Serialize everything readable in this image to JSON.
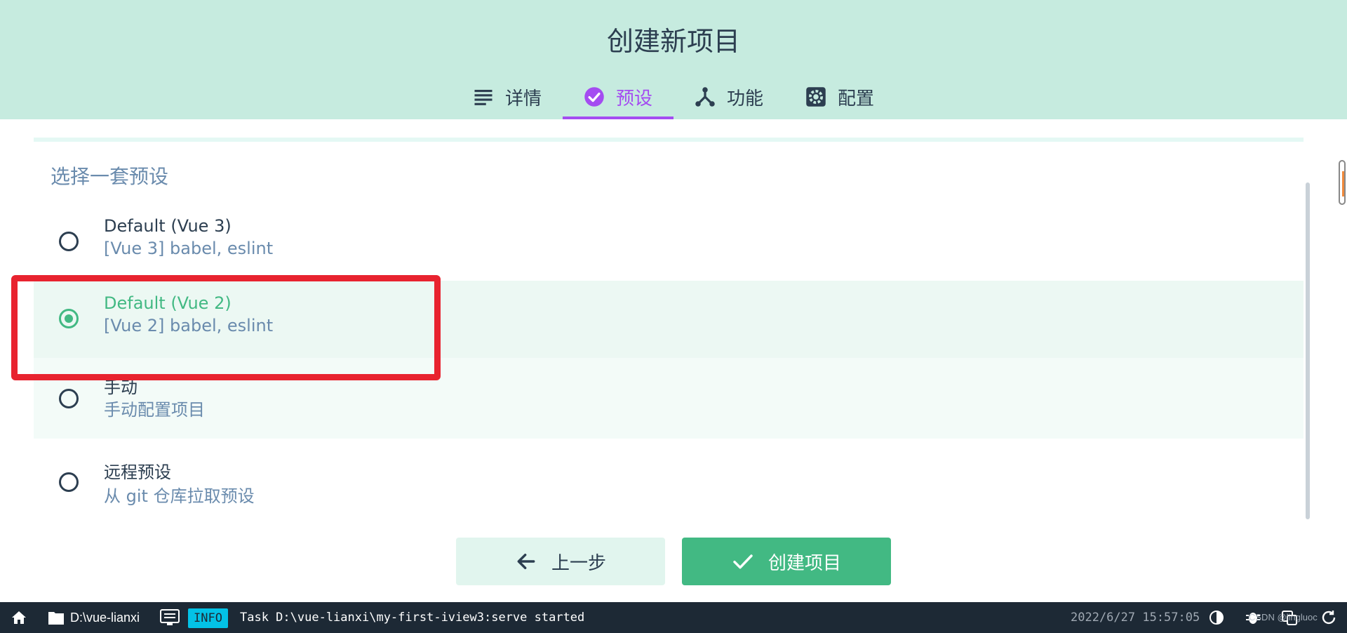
{
  "header": {
    "title": "创建新项目",
    "tabs": [
      {
        "label": "详情",
        "icon": "list-icon",
        "active": false
      },
      {
        "label": "预设",
        "icon": "check-circle-icon",
        "active": true
      },
      {
        "label": "功能",
        "icon": "merge-icon",
        "active": false
      },
      {
        "label": "配置",
        "icon": "gear-icon",
        "active": false
      }
    ]
  },
  "main": {
    "section_title": "选择一套预设",
    "presets": [
      {
        "name": "Default (Vue 3)",
        "description": "[Vue 3] babel, eslint",
        "selected": false
      },
      {
        "name": "Default (Vue 2)",
        "description": "[Vue 2] babel, eslint",
        "selected": true
      },
      {
        "name": "手动",
        "description": "手动配置项目",
        "selected": false
      },
      {
        "name": "远程预设",
        "description": "从 git 仓库拉取预设",
        "selected": false
      }
    ],
    "prev_button": "上一步",
    "create_button": "创建项目"
  },
  "statusbar": {
    "path": "D:\\vue-lianxi",
    "badge": "INFO",
    "log": "Task D:\\vue-lianxi\\my-first-iview3:serve started",
    "time": "2022/6/27 15:57:05",
    "watermark": "CSDN @lingluoc"
  },
  "colors": {
    "header_bg": "#c6ebdf",
    "accent_purple": "#a44cf1",
    "accent_green": "#42b983",
    "statusbar_bg": "#1d2935",
    "info_badge": "#03c2e6",
    "highlight_red": "#e8232f"
  }
}
